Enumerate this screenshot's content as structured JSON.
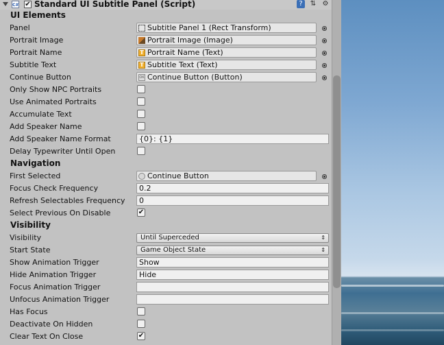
{
  "header": {
    "title": "Standard UI Subtitle Panel (Script)",
    "enabled": true,
    "icons": [
      "fold-arrow-icon",
      "script-icon",
      "help-book-icon",
      "presets-sliders-icon",
      "gear-icon"
    ]
  },
  "sections": {
    "ui_elements": "UI Elements",
    "navigation": "Navigation",
    "visibility": "Visibility"
  },
  "ui_elements": {
    "panel": {
      "label": "Panel",
      "value": "Subtitle Panel 1 (Rect Transform)",
      "icon": "rect-transform-icon"
    },
    "portrait_image": {
      "label": "Portrait Image",
      "value": "Portrait Image (Image)",
      "icon": "image-icon"
    },
    "portrait_name": {
      "label": "Portrait Name",
      "value": "Portrait Name (Text)",
      "icon": "text-icon"
    },
    "subtitle_text": {
      "label": "Subtitle Text",
      "value": "Subtitle Text (Text)",
      "icon": "text-icon"
    },
    "continue_button": {
      "label": "Continue Button",
      "value": "Continue Button (Button)",
      "icon": "button-icon"
    },
    "only_show_npc": {
      "label": "Only Show NPC Portraits",
      "checked": false
    },
    "use_animated": {
      "label": "Use Animated Portraits",
      "checked": false
    },
    "accumulate_text": {
      "label": "Accumulate Text",
      "checked": false
    },
    "add_speaker_name": {
      "label": "Add Speaker Name",
      "checked": false
    },
    "speaker_name_format": {
      "label": "Add Speaker Name Format",
      "value": "{0}: {1}"
    },
    "delay_typewriter": {
      "label": "Delay Typewriter Until Open",
      "checked": false
    }
  },
  "navigation": {
    "first_selected": {
      "label": "First Selected",
      "value": "Continue Button",
      "icon": "game-object-icon"
    },
    "focus_check_frequency": {
      "label": "Focus Check Frequency",
      "value": "0.2"
    },
    "refresh_frequency": {
      "label": "Refresh Selectables Frequency",
      "value": "0"
    },
    "select_previous": {
      "label": "Select Previous On Disable",
      "checked": true
    }
  },
  "visibility": {
    "visibility": {
      "label": "Visibility",
      "value": "Until Superceded"
    },
    "start_state": {
      "label": "Start State",
      "value": "Game Object State"
    },
    "show_trigger": {
      "label": "Show Animation Trigger",
      "value": "Show"
    },
    "hide_trigger": {
      "label": "Hide Animation Trigger",
      "value": "Hide"
    },
    "focus_trigger": {
      "label": "Focus Animation Trigger",
      "value": ""
    },
    "unfocus_trigger": {
      "label": "Unfocus Animation Trigger",
      "value": ""
    },
    "has_focus": {
      "label": "Has Focus",
      "checked": false
    },
    "deactivate_on_hidden": {
      "label": "Deactivate On Hidden",
      "checked": false
    },
    "clear_text_on_close": {
      "label": "Clear Text On Close",
      "checked": true
    }
  },
  "marks": {
    "check": "✔",
    "dropdown_arrow": "⇕",
    "text_icon_glyph": "T",
    "button_icon_glyph": "OK",
    "script_icon_glyph": "C#"
  }
}
